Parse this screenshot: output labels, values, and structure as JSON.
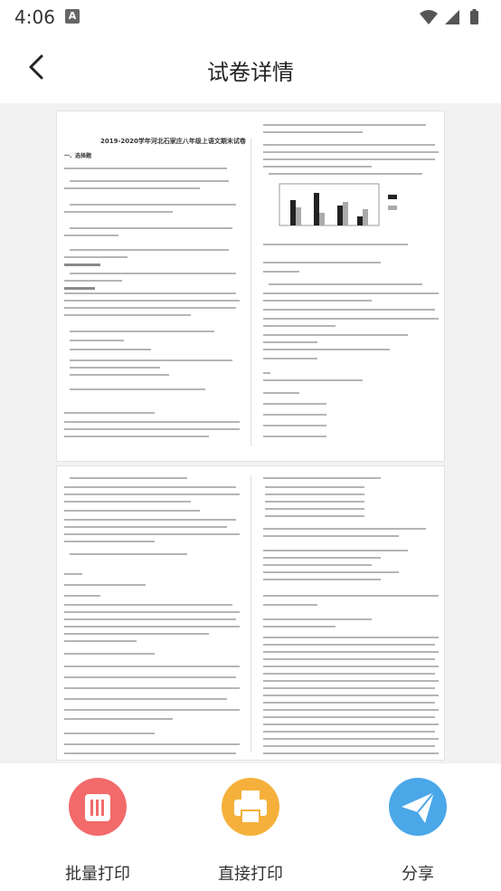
{
  "status_bar": {
    "time": "4:06",
    "notification_letter": "A"
  },
  "nav": {
    "title": "试卷详情"
  },
  "document": {
    "heading": "2019-2020学年河北石家庄八年级上语文期末试卷",
    "page1_left": [
      "一、选择题",
      "二、读写",
      "三、阅读理解"
    ],
    "page2_right": [
      "五、名著阅读",
      "六、现代文阅读"
    ]
  },
  "actions": [
    {
      "label": "批量打印",
      "icon": "batch-print-icon",
      "color": "#f26a6a"
    },
    {
      "label": "直接打印",
      "icon": "printer-icon",
      "color": "#f5b03b"
    },
    {
      "label": "分享",
      "icon": "share-icon",
      "color": "#4aa7e8"
    }
  ]
}
